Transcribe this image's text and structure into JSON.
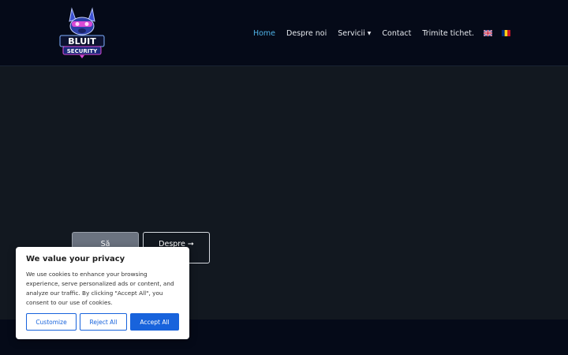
{
  "header": {
    "logo_alt": "Bluit Security",
    "logo_word1": "BLUIT",
    "logo_word2": "SECURITY"
  },
  "nav": {
    "items": [
      {
        "label": "Home",
        "active": true
      },
      {
        "label": "Despre noi"
      },
      {
        "label": "Servicii",
        "has_dropdown": true
      },
      {
        "label": "Contact"
      },
      {
        "label": "Trimite tichet."
      }
    ],
    "languages": [
      {
        "name": "english-flag-icon"
      },
      {
        "name": "romanian-flag-icon"
      }
    ]
  },
  "hero": {
    "primary_button": "Să",
    "secondary_button": "Despre ➞"
  },
  "cookie": {
    "title": "We value your privacy",
    "text": "We use cookies to enhance your browsing experience, serve personalized ads or content, and analyze our traffic. By clicking \"Accept All\", you consent to our use of cookies.",
    "customize": "Customize",
    "reject": "Reject All",
    "accept": "Accept All"
  },
  "colors": {
    "header_bg": "#050a18",
    "hero_bg": "#121820",
    "nav_active": "#4fb3e8",
    "cookie_accent": "#1863dc"
  }
}
